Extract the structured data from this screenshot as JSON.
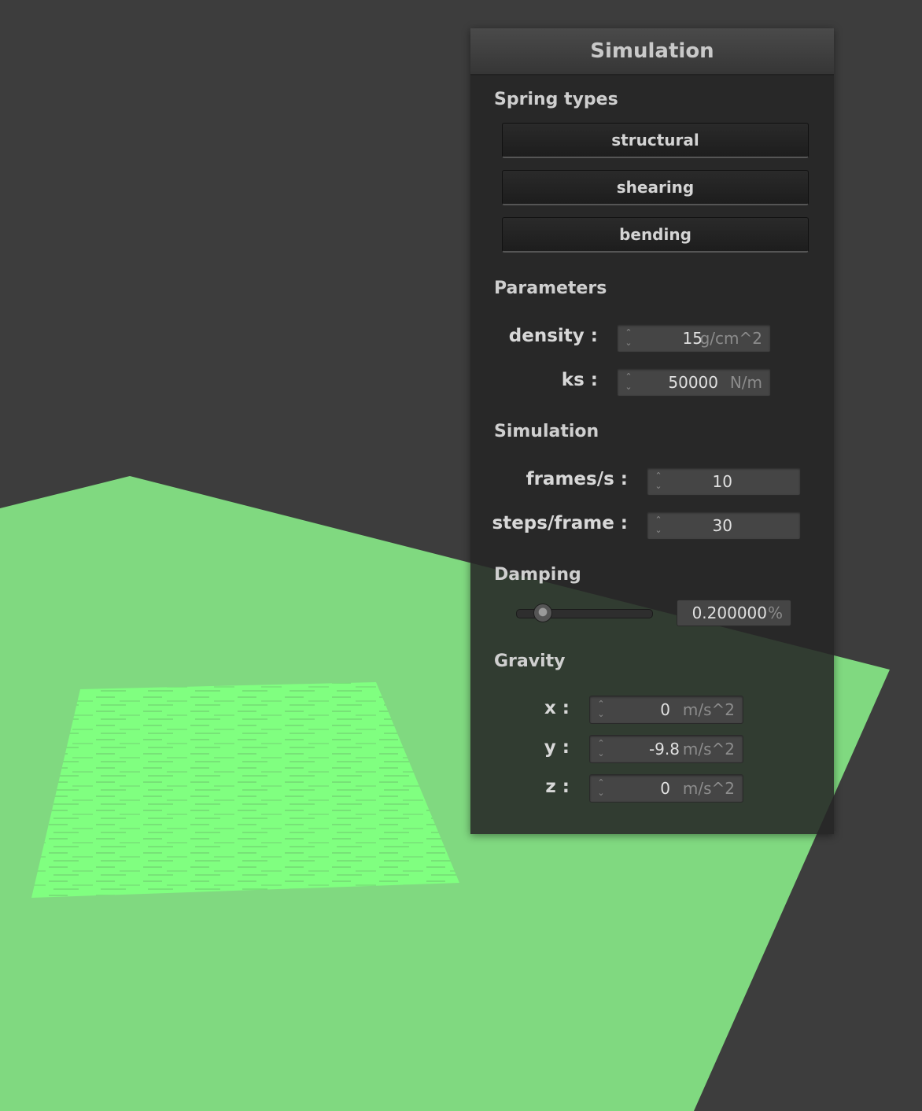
{
  "colors": {
    "background": "#3d3d3d",
    "floor": "#80d980",
    "cloth": "#80ff80",
    "panel": "#262626"
  },
  "panel": {
    "title": "Simulation",
    "spring_types": {
      "title": "Spring types",
      "buttons": [
        "structural",
        "shearing",
        "bending"
      ]
    },
    "parameters": {
      "title": "Parameters",
      "density": {
        "label": "density :",
        "value": "15",
        "unit": "g/cm^2"
      },
      "ks": {
        "label": "ks :",
        "value": "50000",
        "unit": "N/m"
      }
    },
    "simulation": {
      "title": "Simulation",
      "frames": {
        "label": "frames/s :",
        "value": "10"
      },
      "steps": {
        "label": "steps/frame :",
        "value": "30"
      }
    },
    "damping": {
      "title": "Damping",
      "value": "0.200000",
      "unit": "%",
      "slider_fraction": 0.2
    },
    "gravity": {
      "title": "Gravity",
      "x": {
        "label": "x :",
        "value": "0",
        "unit": "m/s^2"
      },
      "y": {
        "label": "y :",
        "value": "-9.8",
        "unit": "m/s^2"
      },
      "z": {
        "label": "z :",
        "value": "0",
        "unit": "m/s^2"
      }
    }
  }
}
